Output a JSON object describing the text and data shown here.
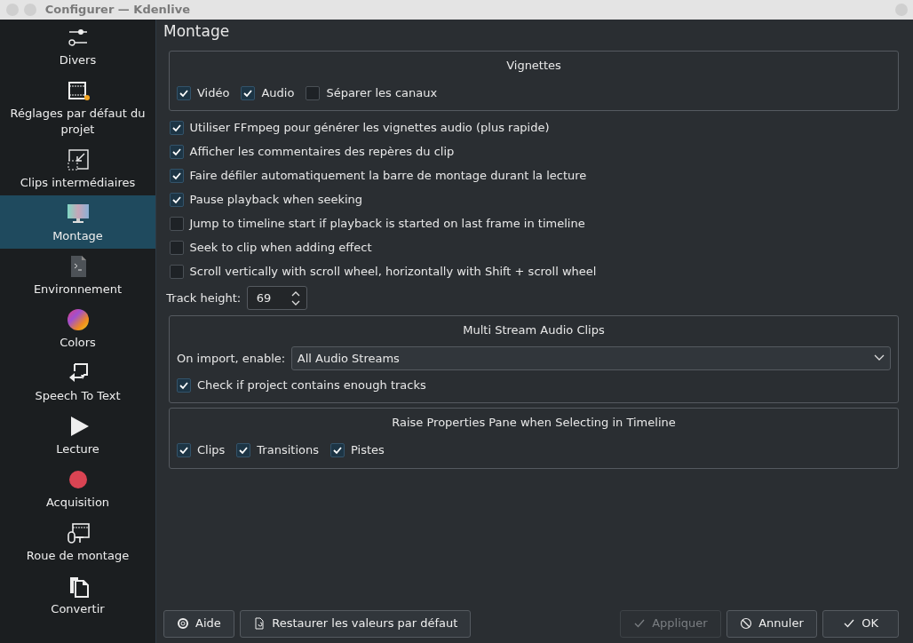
{
  "window": {
    "title": "Configurer — Kdenlive"
  },
  "sidebar": {
    "items": [
      {
        "label": "Divers",
        "selected": false
      },
      {
        "label": "Réglages par défaut du projet",
        "selected": false
      },
      {
        "label": "Clips intermédiaires",
        "selected": false
      },
      {
        "label": "Montage",
        "selected": true
      },
      {
        "label": "Environnement",
        "selected": false
      },
      {
        "label": "Colors",
        "selected": false
      },
      {
        "label": "Speech To Text",
        "selected": false
      },
      {
        "label": "Lecture",
        "selected": false
      },
      {
        "label": "Acquisition",
        "selected": false
      },
      {
        "label": "Roue de montage",
        "selected": false
      },
      {
        "label": "Convertir",
        "selected": false
      }
    ]
  },
  "page": {
    "title": "Montage",
    "vignettes": {
      "title": "Vignettes",
      "options": [
        {
          "label": "Vidéo",
          "checked": true
        },
        {
          "label": "Audio",
          "checked": true
        },
        {
          "label": "Séparer les canaux",
          "checked": false
        }
      ]
    },
    "options": [
      {
        "label": "Utiliser FFmpeg pour générer les vignettes audio (plus rapide)",
        "checked": true
      },
      {
        "label": "Afficher les commentaires des repères du clip",
        "checked": true
      },
      {
        "label": "Faire défiler automatiquement la barre de montage durant la lecture",
        "checked": true
      },
      {
        "label": "Pause playback when seeking",
        "checked": true
      },
      {
        "label": "Jump to timeline start if playback is started on last frame in timeline",
        "checked": false
      },
      {
        "label": "Seek to clip when adding effect",
        "checked": false
      },
      {
        "label": "Scroll vertically with scroll wheel, horizontally with Shift + scroll wheel",
        "checked": false
      }
    ],
    "track_height": {
      "label": "Track height:",
      "value": "69"
    },
    "multi_stream": {
      "title": "Multi Stream Audio Clips",
      "import_label": "On import, enable:",
      "import_value": "All Audio Streams",
      "options": [
        {
          "label": "Check if project contains enough tracks",
          "checked": true
        }
      ]
    },
    "raise_pane": {
      "title": "Raise Properties Pane when Selecting in Timeline",
      "options": [
        {
          "label": "Clips",
          "checked": true
        },
        {
          "label": "Transitions",
          "checked": true
        },
        {
          "label": "Pistes",
          "checked": true
        }
      ]
    }
  },
  "buttons": [
    {
      "label": "Aide",
      "kind": "help",
      "disabled": false
    },
    {
      "label": "Restaurer les valeurs par défaut",
      "kind": "restore",
      "disabled": false
    },
    {
      "label": "Appliquer",
      "kind": "apply",
      "disabled": true
    },
    {
      "label": "Annuler",
      "kind": "cancel",
      "disabled": false
    },
    {
      "label": "OK",
      "kind": "ok",
      "disabled": false
    }
  ]
}
